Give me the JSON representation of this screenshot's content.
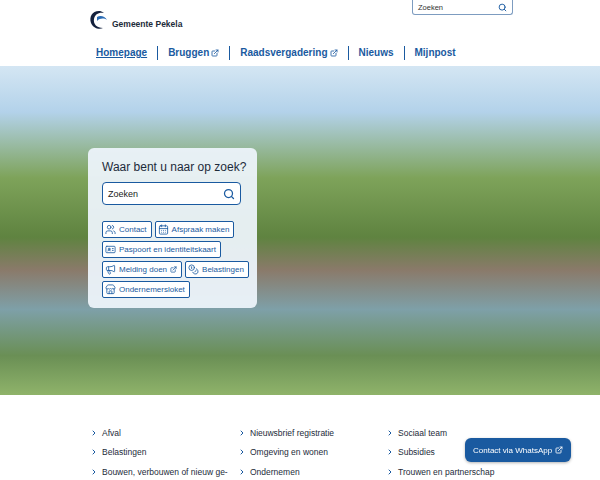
{
  "logo": {
    "text": "Gemeente Pekela"
  },
  "header_search": {
    "placeholder": "Zoeken"
  },
  "nav": [
    {
      "label": "Homepage",
      "selected": true,
      "external": false
    },
    {
      "label": "Bruggen",
      "selected": false,
      "external": true
    },
    {
      "label": "Raadsvergadering",
      "selected": false,
      "external": true
    },
    {
      "label": "Nieuws",
      "selected": false,
      "external": false
    },
    {
      "label": "Mijnpost",
      "selected": false,
      "external": false
    }
  ],
  "hero": {
    "title": "Waar bent u naar op zoek?",
    "search": {
      "placeholder": "Zoeken"
    },
    "buttons": [
      {
        "label": "Contact",
        "external": false
      },
      {
        "label": "Afspraak maken",
        "external": false
      },
      {
        "label": "Paspoort en identiteitskaart",
        "external": false
      },
      {
        "label": "Melding doen",
        "external": true
      },
      {
        "label": "Belastingen",
        "external": false
      },
      {
        "label": "Ondernemersloket",
        "external": false
      }
    ]
  },
  "links": {
    "columns": [
      [
        "Afval",
        "Belastingen",
        "Bouwen, verbouwen of nieuw ge-"
      ],
      [
        "Nieuwsbrief registratie",
        "Omgeving en wonen",
        "Ondernemen"
      ],
      [
        "Sociaal team",
        "Subsidies",
        "Trouwen en partnerschap"
      ]
    ]
  },
  "whatsapp": {
    "label": "Contact via WhatsApp",
    "external": true
  }
}
